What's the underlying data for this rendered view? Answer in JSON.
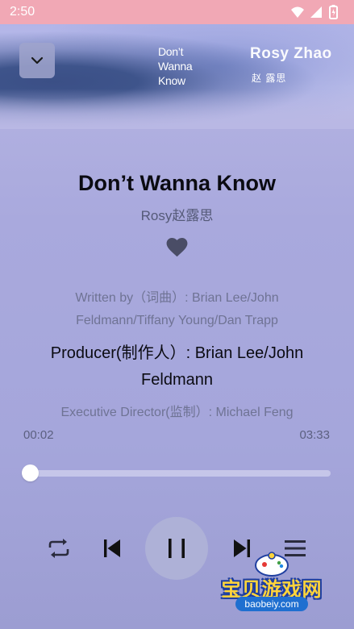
{
  "status_bar": {
    "time": "2:50"
  },
  "cover": {
    "title_lines": [
      "Don’t",
      "Wanna",
      "Know"
    ],
    "artist": "Rosy Zhao",
    "artist_cn": "赵 露思"
  },
  "song": {
    "title": "Don’t Wanna Know",
    "artist": "Rosy赵露思",
    "liked": true
  },
  "lyrics": [
    {
      "text": "Written by（词曲）: Brian Lee/John Feldmann/Tiffany Young/Dan Trapp",
      "active": false
    },
    {
      "text": "Producer(制作人）: Brian Lee/John Feldmann",
      "active": true
    },
    {
      "text": "Executive Director(监制）: Michael Feng",
      "active": false
    }
  ],
  "playback": {
    "elapsed": "00:02",
    "duration": "03:33",
    "progress_fraction": 0.01,
    "state": "playing"
  },
  "controls": {
    "repeat_icon": "repeat-icon",
    "prev_icon": "skip-previous-icon",
    "play_pause_icon": "pause-icon",
    "next_icon": "skip-next-icon",
    "playlist_icon": "playlist-icon"
  },
  "watermark": {
    "text": "宝贝游戏网",
    "url": "baobeiy.com"
  },
  "colors": {
    "status_bar": "#f1a8b5",
    "background": "#a9a9dd",
    "accent_text": "#0b0b12"
  }
}
